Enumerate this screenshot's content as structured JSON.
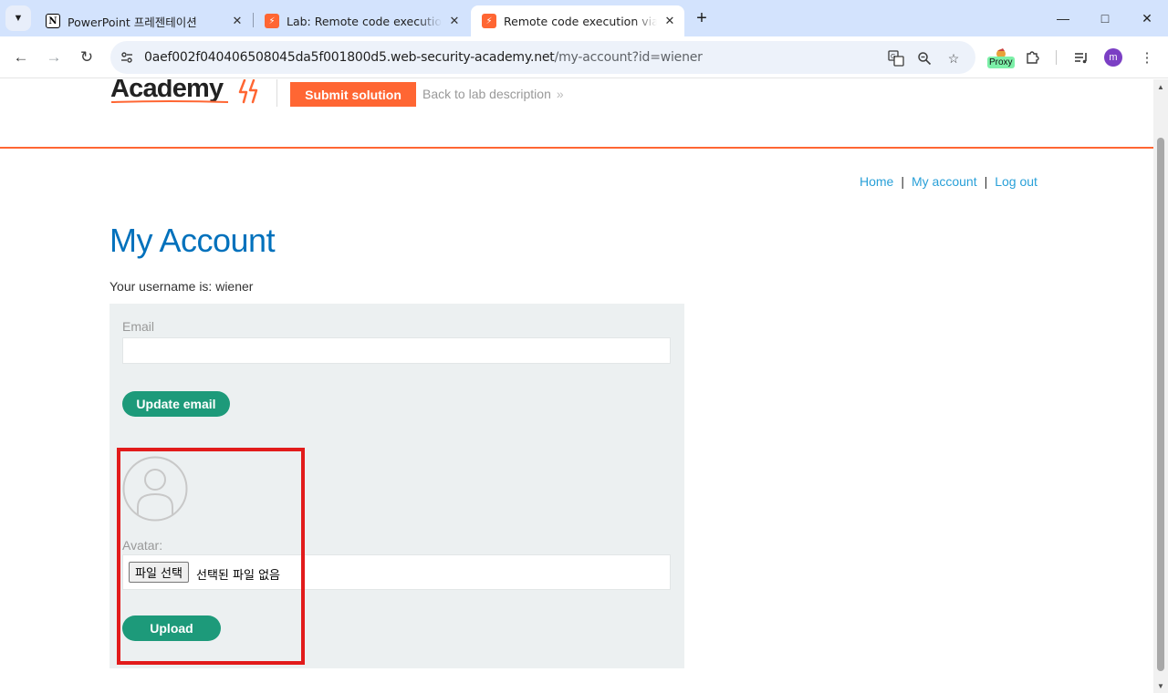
{
  "browser": {
    "tabs": [
      {
        "title": "PowerPoint 프레젠테이션",
        "favicon": "notion-icon",
        "active": false
      },
      {
        "title": "Lab: Remote code execution via web shell upload",
        "favicon": "portswigger-icon",
        "active": false
      },
      {
        "title": "Remote code execution via web shell upload",
        "favicon": "portswigger-icon",
        "active": true
      }
    ],
    "url_host": "0aef002f040406508045da5f001800d5.web-security-academy.net",
    "url_path": "/my-account?id=wiener",
    "profile_initial": "m",
    "proxy_label": "Proxy"
  },
  "header": {
    "logo_text": "Academy",
    "submit_label": "Submit solution",
    "back_label": "Back to lab description"
  },
  "nav": {
    "home": "Home",
    "my_account": "My account",
    "log_out": "Log out",
    "separator": "|"
  },
  "page": {
    "title": "My Account",
    "username_line": "Your username is: wiener"
  },
  "form": {
    "email_label": "Email",
    "email_value": "",
    "update_email_label": "Update email",
    "avatar_label": "Avatar:",
    "file_button_label": "파일 선택",
    "file_status": "선택된 파일 없음",
    "upload_label": "Upload"
  },
  "colors": {
    "accent_orange": "#ff6633",
    "title_blue": "#0071bc",
    "link_blue": "#29a0d8",
    "button_green": "#1d9a7a",
    "highlight_red": "#e21b1b"
  }
}
